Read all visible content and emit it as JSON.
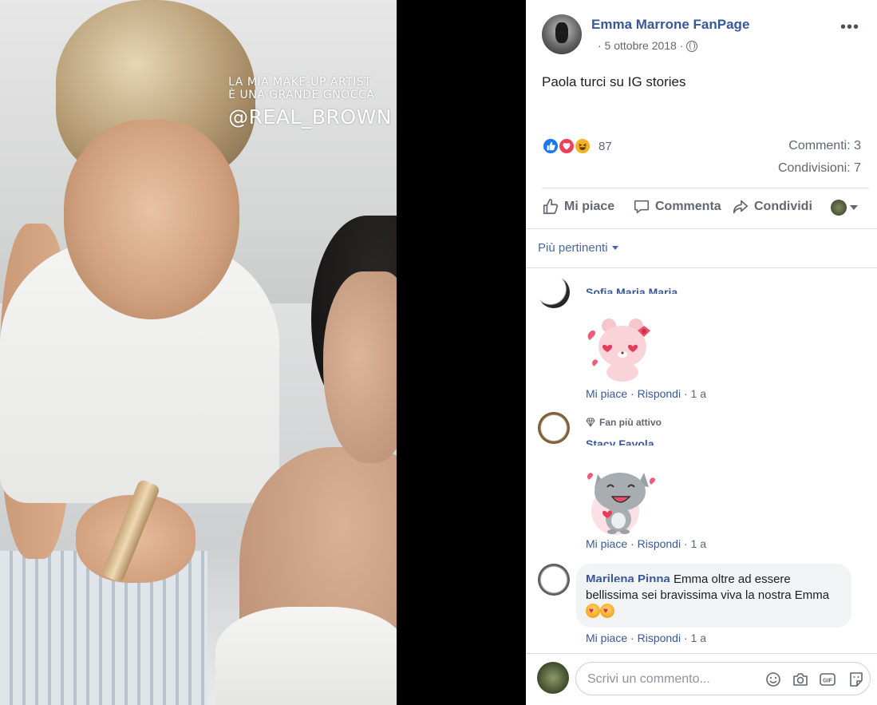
{
  "photo": {
    "caption_line1": "LA MIA MAKE-UP ARTIST",
    "caption_line2": "È UNA GRANDE GNOCCA",
    "caption_handle": "@REAL_BROWN"
  },
  "post": {
    "page_name": "Emma Marrone FanPage",
    "date": "· 5 ottobre 2018 ·",
    "privacy_icon": "globe-icon",
    "more_icon": "ellipsis-icon",
    "text": "Paola turci su IG stories",
    "reactions_count": "87",
    "reaction_types": [
      "like",
      "love",
      "haha"
    ],
    "comments_label": "Commenti: 3",
    "shares_label": "Condivisioni: 7"
  },
  "actions": {
    "like": "Mi piace",
    "comment": "Commenta",
    "share": "Condividi"
  },
  "sort": {
    "label": "Più pertinenti"
  },
  "comments": [
    {
      "name": "Sofia Maria Maria",
      "sticker": "pink-bear-hearts",
      "like": "Mi piace",
      "reply": "Rispondi",
      "time": "1 a"
    },
    {
      "badge": "Fan più attivo",
      "name": "Stacy Favola",
      "sticker": "grey-cat-hearts",
      "like": "Mi piace",
      "reply": "Rispondi",
      "time": "1 a"
    },
    {
      "name": "Marilena Pinna",
      "text": "Emma oltre ad essere bellissima sei bravissima viva la nostra Emma",
      "like": "Mi piace",
      "reply": "Rispondi",
      "time": "1 a"
    }
  ],
  "composer": {
    "placeholder": "Scrivi un commento...",
    "tools": [
      "emoji-icon",
      "camera-icon",
      "gif-icon",
      "sticker-icon"
    ]
  },
  "colors": {
    "link_blue": "#385898",
    "like_blue": "#1877f2",
    "love_red": "#f33e58",
    "haha_yellow": "#f7b125",
    "muted_gray": "#606770"
  }
}
